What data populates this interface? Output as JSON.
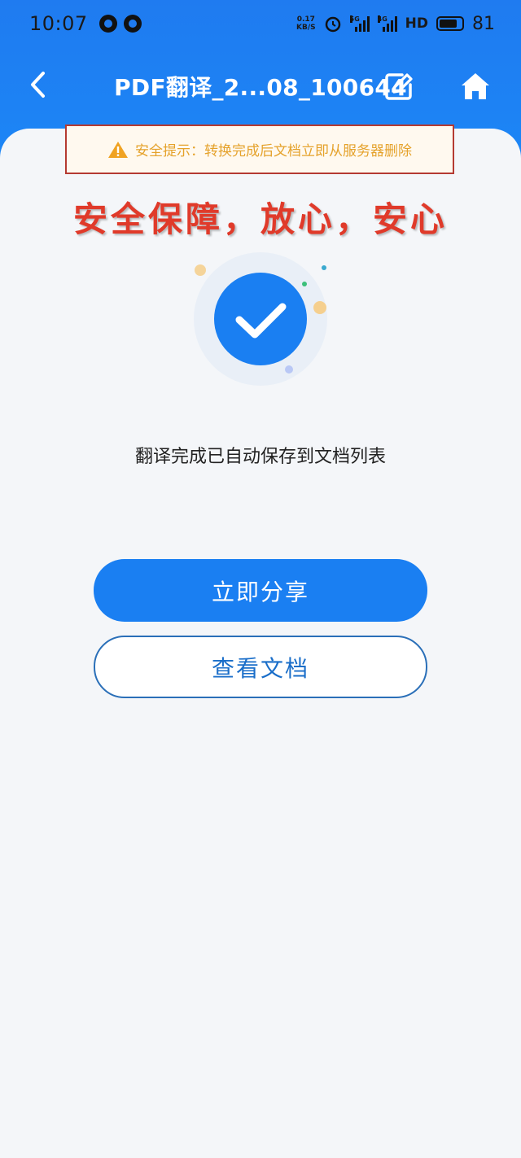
{
  "status_bar": {
    "time": "10:07",
    "net_speed_value": "0.17",
    "net_speed_unit": "KB/S",
    "signal1_label": "5G",
    "signal2_label": "4G",
    "hd_label": "HD",
    "battery": "81",
    "battery_level": 0.81
  },
  "nav": {
    "title": "PDF翻译_2...08_100644"
  },
  "tip": {
    "text": "安全提示：转换完成后文档立即从服务器删除"
  },
  "headline": "安全保障，放心，安心",
  "result": {
    "message": "翻译完成已自动保存到文档列表"
  },
  "buttons": {
    "share_label": "立即分享",
    "view_label": "查看文档"
  },
  "colors": {
    "brand_blue": "#1a7ff2",
    "tip_orange": "#e5a22b",
    "headline_red": "#e03a2a"
  }
}
